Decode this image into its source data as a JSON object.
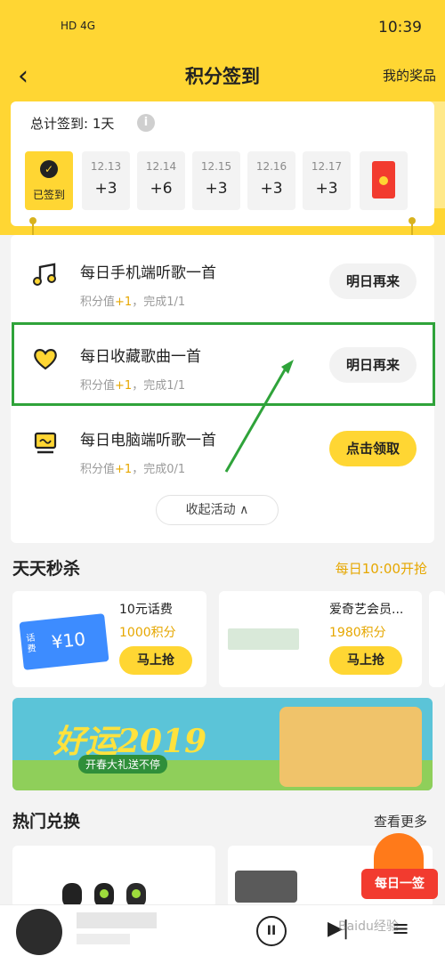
{
  "status_bar": {
    "network": "HD 4G",
    "time": "10:39"
  },
  "nav": {
    "back_icon": "chevron-left-icon",
    "title": "积分签到",
    "right_link": "我的奖品"
  },
  "sign": {
    "total_label": "总计签到: 1天",
    "info_icon": "i",
    "signed_label": "已签到",
    "days": [
      {
        "date": "12.13",
        "points": "+3"
      },
      {
        "date": "12.14",
        "points": "+6"
      },
      {
        "date": "12.15",
        "points": "+3"
      },
      {
        "date": "12.16",
        "points": "+3"
      },
      {
        "date": "12.17",
        "points": "+3"
      }
    ]
  },
  "tasks": [
    {
      "name": "每日手机端听歌一首",
      "meta_prefix": "积分值",
      "meta_plus": "+1",
      "meta_suffix": "，完成1/1",
      "button": "明日再来",
      "icon": "music-note-icon"
    },
    {
      "name": "每日收藏歌曲一首",
      "meta_prefix": "积分值",
      "meta_plus": "+1",
      "meta_suffix": "，完成1/1",
      "button": "明日再来",
      "icon": "heart-icon"
    },
    {
      "name": "每日电脑端听歌一首",
      "meta_prefix": "积分值",
      "meta_plus": "+1",
      "meta_suffix": "，完成0/1",
      "button": "点击领取",
      "icon": "computer-icon"
    }
  ],
  "collapse_label": "收起活动 ∧",
  "flash_sale": {
    "title": "天天秒杀",
    "schedule": "每日10:00开抢",
    "items": [
      {
        "name": "10元话费",
        "points": "1000积分",
        "button": "马上抢",
        "coupon_value": "¥10",
        "coupon_label": "话费"
      },
      {
        "name": "爱奇艺会员...",
        "points": "1980积分",
        "button": "马上抢"
      }
    ]
  },
  "banner": {
    "headline": "好运2019",
    "subtitle": "开春大礼送不停"
  },
  "hot_exchange": {
    "title": "热门兑换",
    "more": "查看更多"
  },
  "daily_badge": "每日一签",
  "player": {
    "pause_icon": "pause-icon",
    "next_icon": "next-icon",
    "list_icon": "playlist-icon"
  },
  "watermark": "Baidu经验"
}
